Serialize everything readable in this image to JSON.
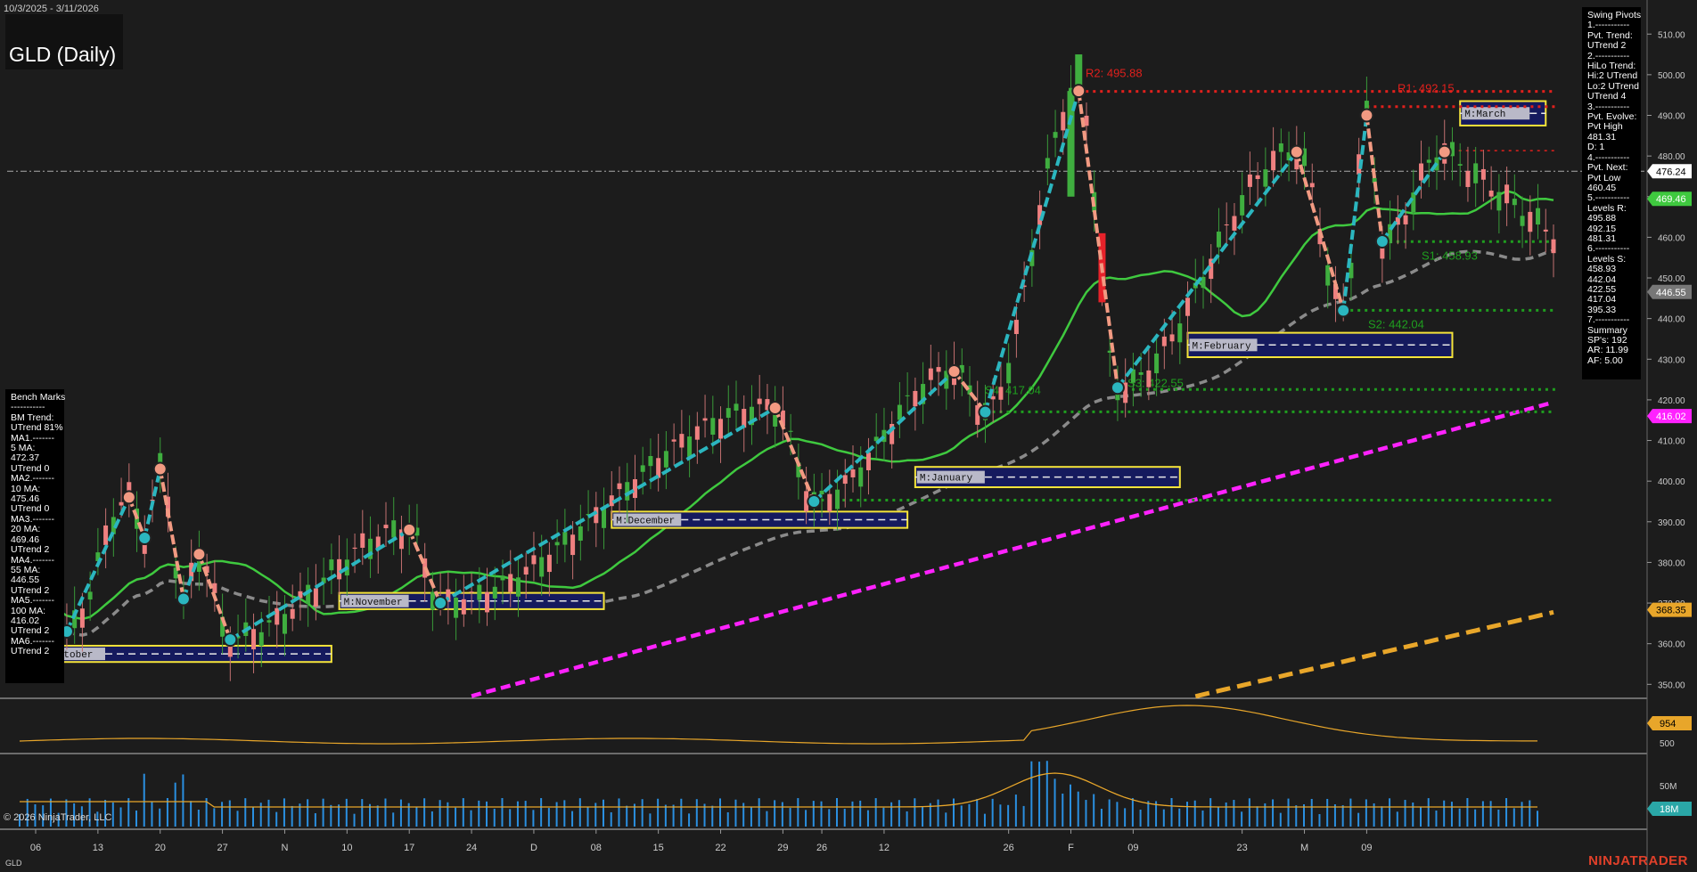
{
  "header": {
    "date_range": "10/3/2025 - 3/11/2026",
    "title": "GLD (Daily)"
  },
  "footer": {
    "copyright": "© 2026 NinjaTrader, LLC",
    "symbol": "GLD",
    "brand": "NINJATRADER"
  },
  "swing_panel": {
    "lines": [
      "Swing Pivots",
      "1.-----------",
      "Pvt. Trend:",
      "UTrend 2",
      "2.-----------",
      "HiLo Trend:",
      "Hi:2 UTrend",
      "Lo:2 UTrend",
      "UTrend 4",
      "3.-----------",
      "Pvt. Evolve:",
      "Pvt High",
      "481.31",
      "D: 1",
      "4.-----------",
      "Pvt. Next:",
      "Pvt Low",
      "460.45",
      "5.-----------",
      "Levels R:",
      "495.88",
      "492.15",
      "481.31",
      "6.-----------",
      "Levels S:",
      "458.93",
      "442.04",
      "422.55",
      "417.04",
      "395.33",
      "7.-----------",
      "Summary",
      "SP's: 192",
      "AR: 11.99",
      "AF: 5.00"
    ]
  },
  "bench_panel": {
    "lines": [
      "Bench Marks",
      "-----------",
      "BM Trend:",
      "UTrend 81%",
      "MA1.-------",
      "5 MA:",
      "472.37",
      "UTrend 0",
      "MA2.-------",
      "10 MA:",
      "475.46",
      "UTrend 0",
      "MA3.-------",
      "20 MA:",
      "469.46",
      "UTrend 2",
      "MA4.-------",
      "55 MA:",
      "446.55",
      "UTrend 2",
      "MA5.-------",
      "100 MA:",
      "416.02",
      "UTrend 2",
      "MA6.-------",
      "UTrend 2"
    ]
  },
  "colors": {
    "green_ma": "#3fc93f",
    "gray_ma": "#8a8a8a",
    "magenta_ma": "#ff22ff",
    "orange_ma": "#e8a62a",
    "swing_up": "#2bb6bf",
    "swing_down": "#f29a82",
    "resistance": "#e0201c",
    "support": "#1f9e1f",
    "box_border": "#f5e43a",
    "box_fill": "#151a5e",
    "volume": "#2a8fe0"
  },
  "chart_data": {
    "type": "candlestick",
    "x_tick_labels": [
      "06",
      "13",
      "20",
      "27",
      "N",
      "10",
      "17",
      "24",
      "D",
      "08",
      "15",
      "22",
      "29",
      "26",
      "12",
      "26",
      "F",
      "09",
      "23",
      "M",
      "09"
    ],
    "price_axis": {
      "ticks": [
        350,
        360,
        370,
        380,
        390,
        400,
        410,
        420,
        430,
        440,
        450,
        460,
        470,
        480,
        490,
        500,
        510
      ],
      "range": [
        347,
        514
      ]
    },
    "price_labels": [
      {
        "value": 476.24,
        "color": "#000000",
        "bg": "#ffffff"
      },
      {
        "value": 469.46,
        "color": "#ffffff",
        "bg": "#3fc93f"
      },
      {
        "value": 446.55,
        "color": "#ffffff",
        "bg": "#777777"
      },
      {
        "value": 416.02,
        "color": "#ffffff",
        "bg": "#ff22ff"
      },
      {
        "value": 368.35,
        "color": "#000000",
        "bg": "#e8a62a"
      }
    ],
    "resistance_levels": [
      {
        "label": "R2: 495.88",
        "value": 495.88
      },
      {
        "label": "R1: 492.15",
        "value": 492.15
      },
      {
        "label": "",
        "value": 481.31
      }
    ],
    "support_levels": [
      {
        "label": "S1: 458.93",
        "value": 458.93
      },
      {
        "label": "S2: 442.04",
        "value": 442.04
      },
      {
        "label": "S3: 422.55",
        "value": 422.55
      },
      {
        "label": "S4: 417.04",
        "value": 417.04
      },
      {
        "label": "",
        "value": 395.33
      }
    ],
    "monthly_boxes": [
      {
        "label": "M:October",
        "lo": 355.5,
        "hi": 359.5,
        "start": 0,
        "end": 38
      },
      {
        "label": "M:November",
        "lo": 368.5,
        "hi": 372.5,
        "start": 39,
        "end": 73
      },
      {
        "label": "M:December",
        "lo": 388.5,
        "hi": 392.5,
        "start": 74,
        "end": 112
      },
      {
        "label": "M:January",
        "lo": 398.5,
        "hi": 403.5,
        "start": 113,
        "end": 147
      },
      {
        "label": "M:February",
        "lo": 430.5,
        "hi": 436.5,
        "start": 148,
        "end": 182
      },
      {
        "label": "M:March",
        "lo": 487.5,
        "hi": 493.5,
        "start": 183,
        "end": 194
      }
    ],
    "swing_points": [
      {
        "i": 1,
        "v": 373
      },
      {
        "i": 4,
        "v": 363
      },
      {
        "i": 12,
        "v": 396
      },
      {
        "i": 14,
        "v": 386
      },
      {
        "i": 16,
        "v": 403
      },
      {
        "i": 19,
        "v": 371
      },
      {
        "i": 21,
        "v": 382
      },
      {
        "i": 25,
        "v": 361
      },
      {
        "i": 48,
        "v": 388
      },
      {
        "i": 52,
        "v": 370
      },
      {
        "i": 95,
        "v": 418
      },
      {
        "i": 100,
        "v": 395
      },
      {
        "i": 118,
        "v": 427
      },
      {
        "i": 122,
        "v": 417
      },
      {
        "i": 134,
        "v": 496
      },
      {
        "i": 139,
        "v": 423
      },
      {
        "i": 162,
        "v": 481
      },
      {
        "i": 168,
        "v": 442
      },
      {
        "i": 171,
        "v": 490
      },
      {
        "i": 173,
        "v": 459
      },
      {
        "i": 181,
        "v": 481
      }
    ],
    "oscillator": {
      "value_label": "954",
      "tick_label": "500"
    },
    "volume": {
      "value_label": "18M",
      "tick_label": "50M"
    }
  }
}
